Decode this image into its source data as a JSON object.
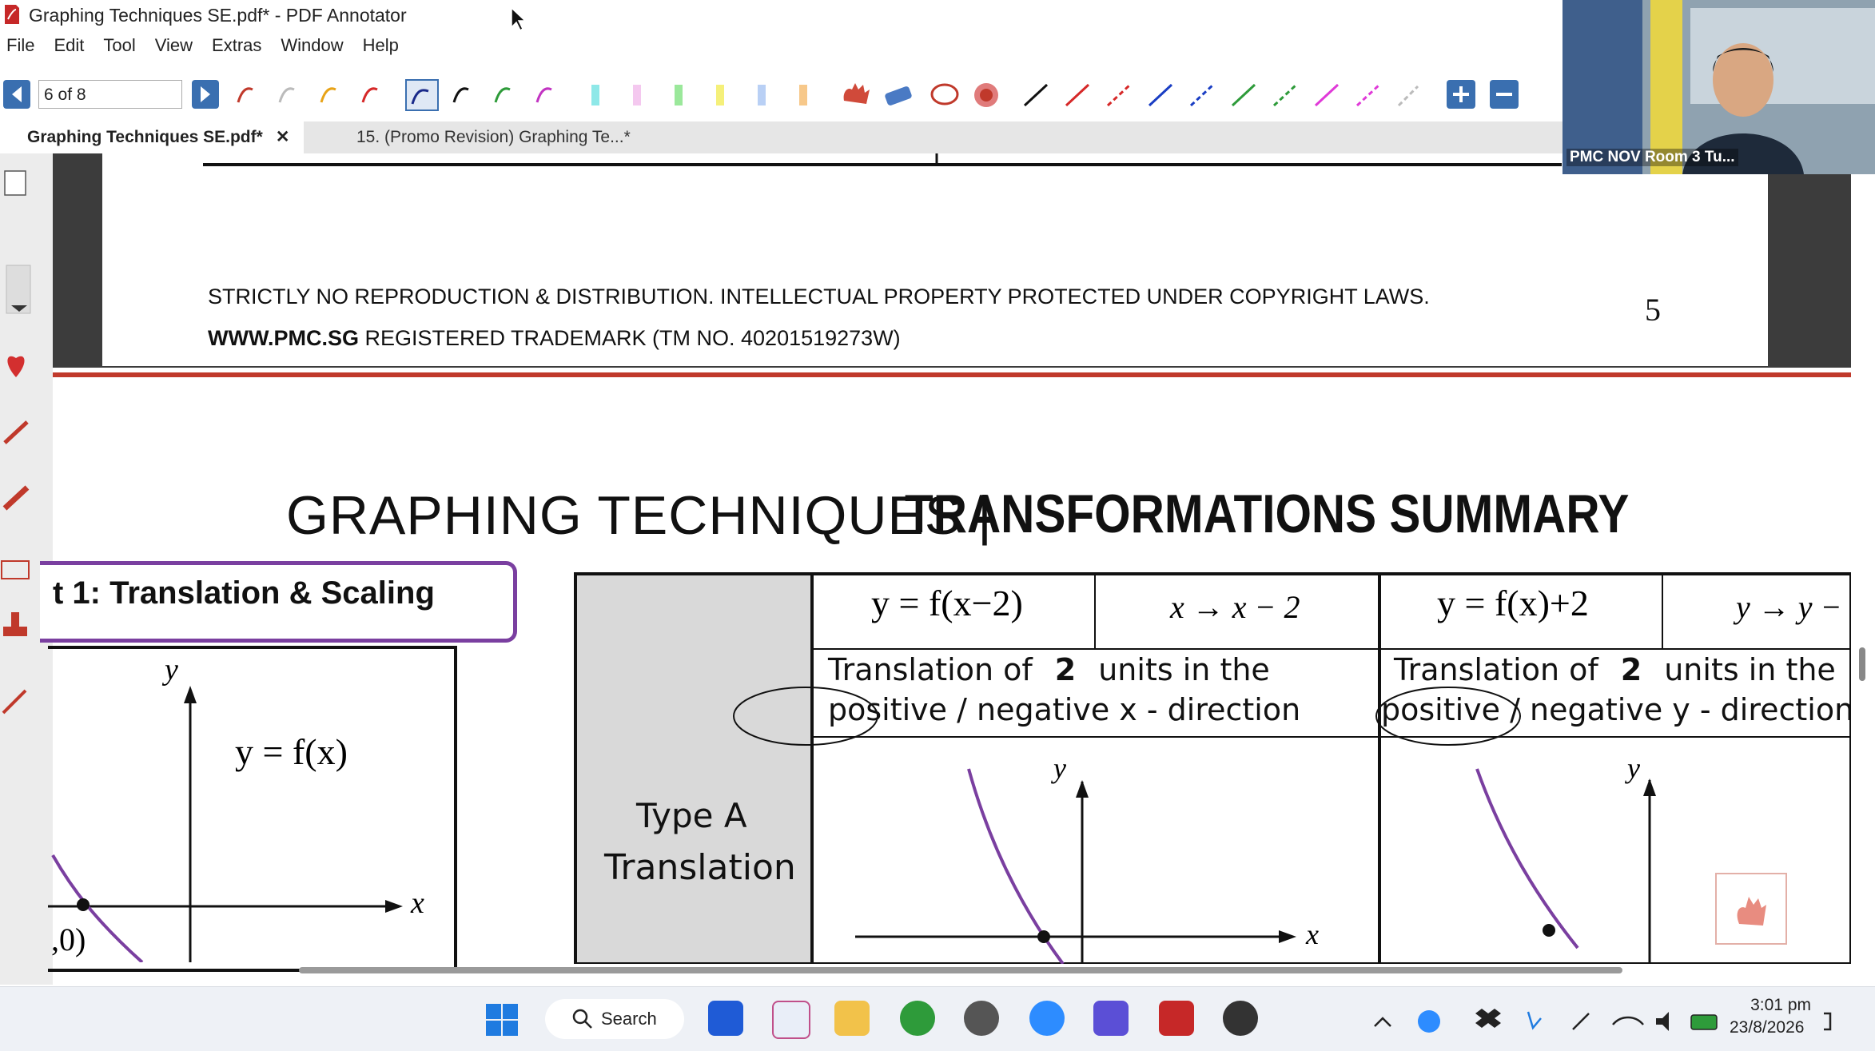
{
  "window": {
    "title": "Graphing Techniques SE.pdf* - PDF Annotator"
  },
  "menu": [
    "File",
    "Edit",
    "Tool",
    "View",
    "Extras",
    "Window",
    "Help"
  ],
  "toolbar": {
    "page_indicator": "6 of 8"
  },
  "tabs": [
    {
      "label": "Graphing Techniques SE.pdf*",
      "close": "✕"
    },
    {
      "label": "15. (Promo Revision) Graphing Te...*"
    }
  ],
  "video": {
    "participant": "PMC NOV Room 3 Tu..."
  },
  "document": {
    "footer_line1": "STRICTLY NO REPRODUCTION & DISTRIBUTION. INTELLECTUAL PROPERTY PROTECTED UNDER COPYRIGHT LAWS.",
    "footer_bold": "WWW.PMC.SG",
    "footer_rest": " REGISTERED TRADEMARK (TM NO. 40201519273W)",
    "page_number": "5",
    "heading_light": "GRAPHING TECHNIQUES |",
    "heading_bold": "TRANSFORMATIONS SUMMARY",
    "part_label": "t 1: Translation & Scaling",
    "graph_function": "y = f(x)",
    "axis_y": "y",
    "axis_x": "x",
    "graph_point": ",0)",
    "row_label_1": "Type A",
    "row_label_2": "Translation",
    "col1_eq": "y = f(x−2)",
    "col1_map": "x → x − 2",
    "col1_desc_a": "Translation of",
    "col1_num": "2",
    "col1_desc_b": "units in the",
    "col1_desc_c": "positive / negative x - direction",
    "col2_eq": "y = f(x)+2",
    "col2_map": "y → y −",
    "col2_desc_a": "Translation of",
    "col2_num": "2",
    "col2_desc_b": "units in the",
    "col2_desc_c": "positive / negative y - direction"
  },
  "taskbar": {
    "search": "Search",
    "time": "3:01 pm",
    "date": "23/8/2026"
  },
  "colors": {
    "accent_purple": "#7a3fa0",
    "red_line": "#c0392b",
    "toolbar_blue": "#3a6fb0"
  }
}
